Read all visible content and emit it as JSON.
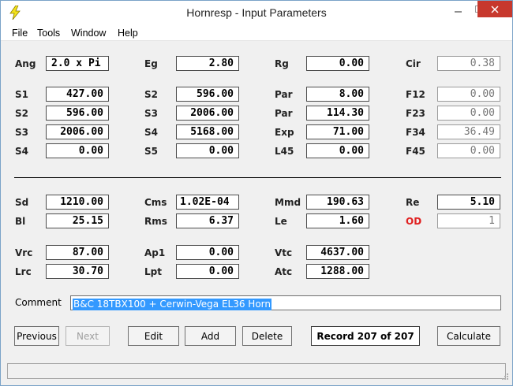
{
  "window": {
    "title": "Hornresp - Input Parameters"
  },
  "menu": {
    "items": [
      "File",
      "Tools",
      "Window",
      "Help"
    ]
  },
  "params": {
    "Ang": {
      "label": "Ang",
      "value": "2.0 x Pi"
    },
    "Eg": {
      "label": "Eg",
      "value": "2.80"
    },
    "Rg": {
      "label": "Rg",
      "value": "0.00"
    },
    "Cir": {
      "label": "Cir",
      "value": "0.38"
    },
    "S1": {
      "label": "S1",
      "value": "427.00"
    },
    "S2a": {
      "label": "S2",
      "value": "596.00"
    },
    "Par1": {
      "label": "Par",
      "value": "8.00"
    },
    "F12": {
      "label": "F12",
      "value": "0.00"
    },
    "S2": {
      "label": "S2",
      "value": "596.00"
    },
    "S3a": {
      "label": "S3",
      "value": "2006.00"
    },
    "Par2": {
      "label": "Par",
      "value": "114.30"
    },
    "F23": {
      "label": "F23",
      "value": "0.00"
    },
    "S3": {
      "label": "S3",
      "value": "2006.00"
    },
    "S4a": {
      "label": "S4",
      "value": "5168.00"
    },
    "Exp": {
      "label": "Exp",
      "value": "71.00"
    },
    "F34": {
      "label": "F34",
      "value": "36.49"
    },
    "S4": {
      "label": "S4",
      "value": "0.00"
    },
    "S5": {
      "label": "S5",
      "value": "0.00"
    },
    "L45": {
      "label": "L45",
      "value": "0.00"
    },
    "F45": {
      "label": "F45",
      "value": "0.00"
    },
    "Sd": {
      "label": "Sd",
      "value": "1210.00"
    },
    "Cms": {
      "label": "Cms",
      "value": "1.02E-04"
    },
    "Mmd": {
      "label": "Mmd",
      "value": "190.63"
    },
    "Re": {
      "label": "Re",
      "value": "5.10"
    },
    "Bl": {
      "label": "Bl",
      "value": "25.15"
    },
    "Rms": {
      "label": "Rms",
      "value": "6.37"
    },
    "Le": {
      "label": "Le",
      "value": "1.60"
    },
    "OD": {
      "label": "OD",
      "value": "1"
    },
    "Vrc": {
      "label": "Vrc",
      "value": "87.00"
    },
    "Ap1": {
      "label": "Ap1",
      "value": "0.00"
    },
    "Vtc": {
      "label": "Vtc",
      "value": "4637.00"
    },
    "Lrc": {
      "label": "Lrc",
      "value": "30.70"
    },
    "Lpt": {
      "label": "Lpt",
      "value": "0.00"
    },
    "Atc": {
      "label": "Atc",
      "value": "1288.00"
    }
  },
  "comment": {
    "label": "Comment",
    "value": "B&C 18TBX100 + Cerwin-Vega EL36 Horn"
  },
  "buttons": {
    "previous": "Previous",
    "next": "Next",
    "edit": "Edit",
    "add": "Add",
    "delete": "Delete",
    "calculate": "Calculate"
  },
  "record": "Record 207 of 207",
  "colors": {
    "accent_red": "#e02020",
    "selection": "#3399ff",
    "close_button": "#c7382d"
  }
}
